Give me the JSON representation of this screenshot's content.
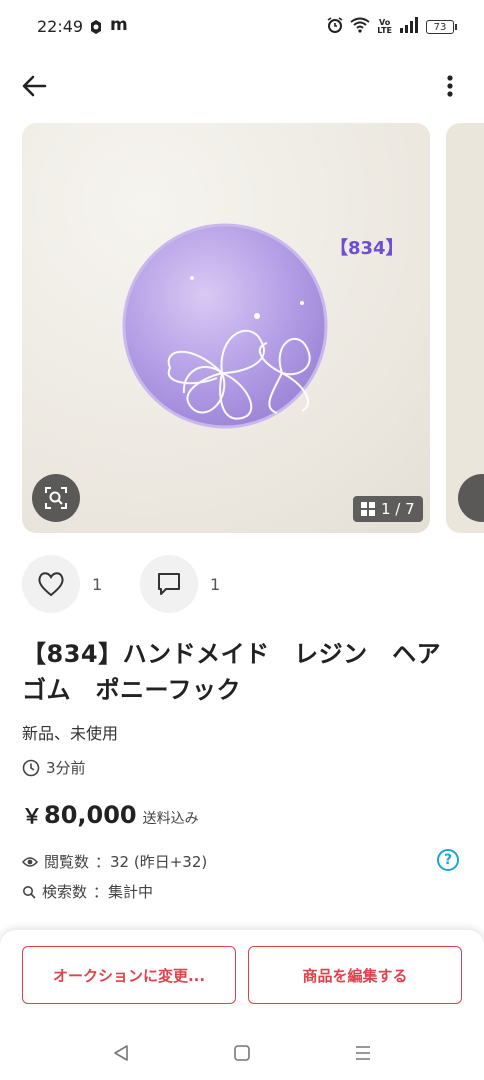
{
  "status_bar": {
    "time": "22:49",
    "notif_app": "m",
    "volte": [
      "Vo",
      "LTE"
    ],
    "battery": "73"
  },
  "gallery": {
    "tag": "【834】",
    "counter": "1 / 7"
  },
  "actions": {
    "likes": "1",
    "comments": "1"
  },
  "product": {
    "title": "【834】ハンドメイド　レジン　ヘアゴム　ポニーフック",
    "condition": "新品、未使用",
    "posted": "3分前",
    "price_symbol": "￥",
    "price": "80,000",
    "shipping": "送料込み",
    "views_label": "閲覧数",
    "views_value": "：32 (昨日+32)",
    "searches_label": "検索数",
    "searches_value": "：集計中"
  },
  "buttons": {
    "auction": "オークションに変更...",
    "edit": "商品を編集する"
  },
  "colors": {
    "accent": "#e0424b",
    "help": "#1aa7d8",
    "tag": "#6c4fd1"
  }
}
